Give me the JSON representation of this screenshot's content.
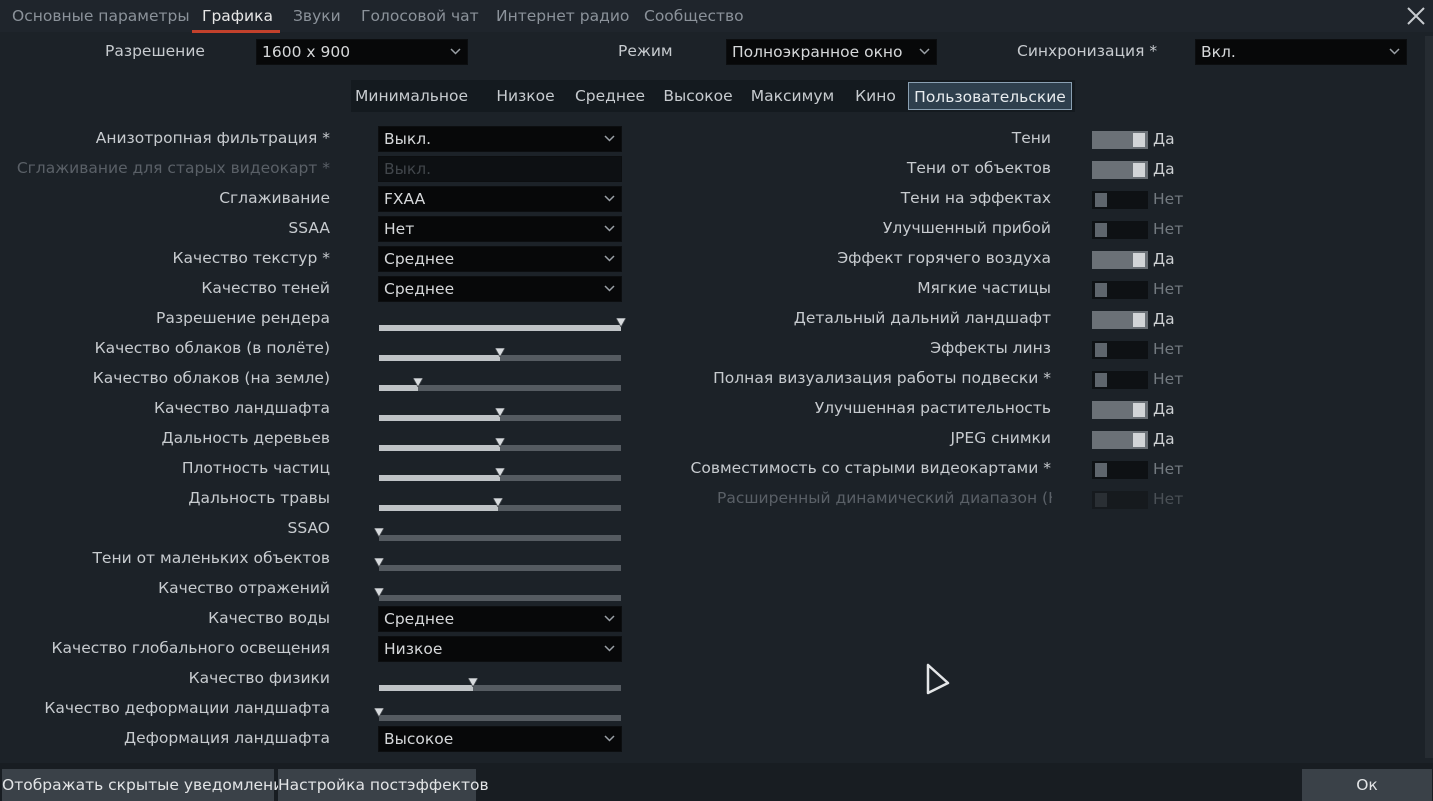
{
  "tabs": [
    "Основные параметры",
    "Графика",
    "Звуки",
    "Голосовой чат",
    "Интернет радио",
    "Сообщество"
  ],
  "active_tab": "Графика",
  "top": {
    "resolution_label": "Разрешение",
    "resolution_value": "1600 x 900",
    "mode_label": "Режим",
    "mode_value": "Полноэкранное окно",
    "sync_label": "Синхронизация *",
    "sync_value": "Вкл."
  },
  "presets": [
    "Минимальное",
    "Низкое",
    "Среднее",
    "Высокое",
    "Максимум",
    "Кино",
    "Пользовательские"
  ],
  "active_preset": "Пользовательские",
  "left_settings": [
    {
      "label": "Анизотропная фильтрация *",
      "type": "combo",
      "value": "Выкл."
    },
    {
      "label": "Сглаживание для старых видеокарт *",
      "type": "combo",
      "value": "Выкл.",
      "disabled": true
    },
    {
      "label": "Сглаживание",
      "type": "combo",
      "value": "FXAA"
    },
    {
      "label": "SSAA",
      "type": "combo",
      "value": "Нет"
    },
    {
      "label": "Качество текстур *",
      "type": "combo",
      "value": "Среднее"
    },
    {
      "label": "Качество теней",
      "type": "combo",
      "value": "Среднее"
    },
    {
      "label": "Разрешение рендера",
      "type": "slider",
      "level": 1.0
    },
    {
      "label": "Качество облаков (в полёте)",
      "type": "slider",
      "level": 0.5
    },
    {
      "label": "Качество облаков (на земле)",
      "type": "slider",
      "level": 0.16
    },
    {
      "label": "Качество ландшафта",
      "type": "slider",
      "level": 0.5
    },
    {
      "label": "Дальность деревьев",
      "type": "slider",
      "level": 0.5
    },
    {
      "label": "Плотность частиц",
      "type": "slider",
      "level": 0.5
    },
    {
      "label": "Дальность травы",
      "type": "slider",
      "level": 0.49
    },
    {
      "label": "SSAO",
      "type": "slider",
      "level": 0.0
    },
    {
      "label": "Тени от маленьких объектов",
      "type": "slider",
      "level": 0.0
    },
    {
      "label": "Качество отражений",
      "type": "slider",
      "level": 0.0
    },
    {
      "label": "Качество воды",
      "type": "combo",
      "value": "Среднее"
    },
    {
      "label": "Качество глобального освещения",
      "type": "combo",
      "value": "Низкое"
    },
    {
      "label": "Качество физики",
      "type": "slider",
      "level": 0.39
    },
    {
      "label": "Качество деформации ландшафта",
      "type": "slider",
      "level": 0.0
    },
    {
      "label": "Деформация ландшафта",
      "type": "combo",
      "value": "Высокое"
    }
  ],
  "right_settings": [
    {
      "label": "Тени",
      "on": true,
      "value": "Да"
    },
    {
      "label": "Тени от объектов",
      "on": true,
      "value": "Да"
    },
    {
      "label": "Тени на эффектах",
      "on": false,
      "value": "Нет"
    },
    {
      "label": "Улучшенный прибой",
      "on": false,
      "value": "Нет"
    },
    {
      "label": "Эффект горячего воздуха",
      "on": true,
      "value": "Да"
    },
    {
      "label": "Мягкие частицы",
      "on": false,
      "value": "Нет"
    },
    {
      "label": "Детальный дальний ландшафт",
      "on": true,
      "value": "Да"
    },
    {
      "label": "Эффекты линз",
      "on": false,
      "value": "Нет"
    },
    {
      "label": "Полная визуализация работы подвески *",
      "on": false,
      "value": "Нет"
    },
    {
      "label": "Улучшенная растительность",
      "on": true,
      "value": "Да"
    },
    {
      "label": "JPEG снимки",
      "on": true,
      "value": "Да"
    },
    {
      "label": "Совместимость со старыми видеокартами *",
      "on": false,
      "value": "Нет"
    },
    {
      "label": "Расширенный динамический диапазон (HDI",
      "on": false,
      "value": "Нет",
      "disabled": true
    }
  ],
  "buttons": {
    "hidden_notifications": "Отображать скрытые уведомления",
    "posteffects": "Настройка постэффектов",
    "ok": "Ок"
  }
}
